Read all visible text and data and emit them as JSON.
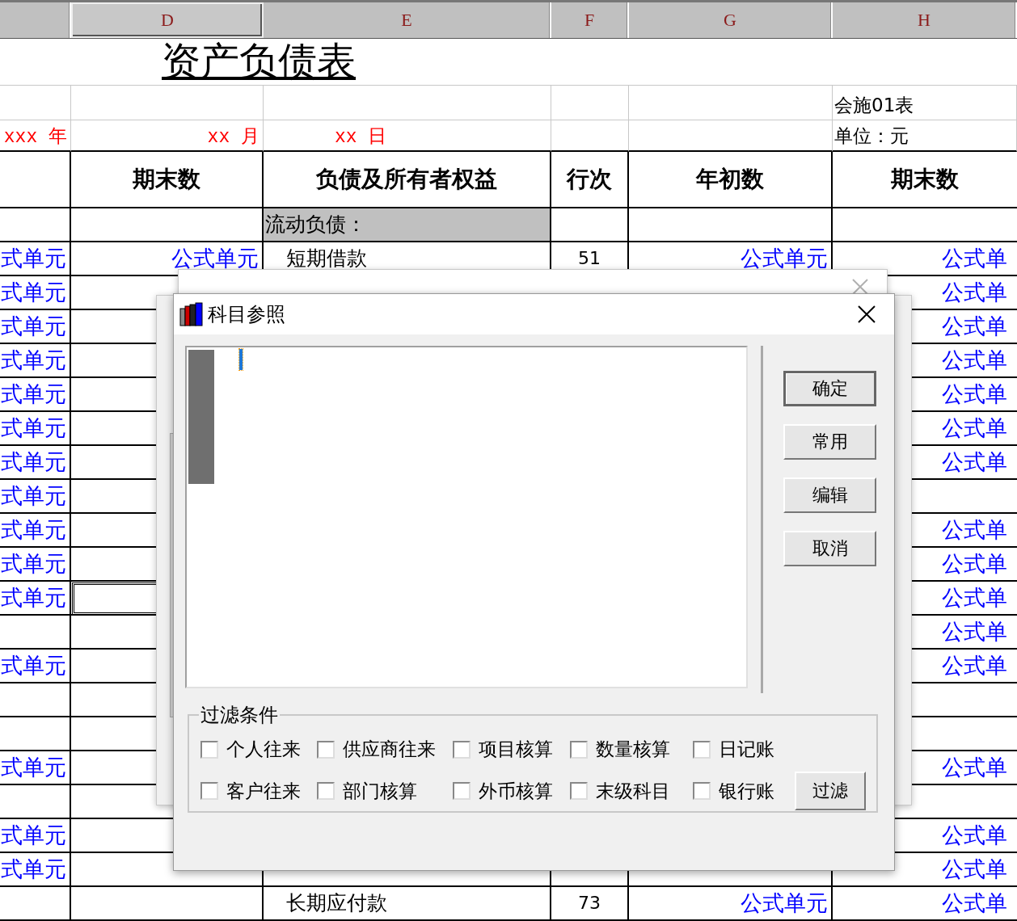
{
  "columns": [
    {
      "label": "D",
      "selected": true
    },
    {
      "label": "E",
      "selected": false
    },
    {
      "label": "F",
      "selected": false
    },
    {
      "label": "G",
      "selected": false
    },
    {
      "label": "H",
      "selected": false
    }
  ],
  "title": "资产负债表",
  "form_no": "会施01表",
  "date": {
    "year": "xxx 年",
    "month": "xx 月",
    "day": "xx 日"
  },
  "unit": "单位：元",
  "table_headers": [
    "期末数",
    "负债及所有者权益",
    "行次",
    "年初数",
    "期末数"
  ],
  "rows": [
    {
      "kind": "section",
      "selected": false,
      "cells": {
        "E": "流动负债："
      }
    },
    {
      "kind": "line",
      "selected": false,
      "cells": {
        "C": "式单元",
        "D": "公式单元",
        "E": "短期借款",
        "F": "51",
        "G": "公式单元",
        "H": "公式单"
      }
    },
    {
      "kind": "line",
      "selected": false,
      "cells": {
        "C": "式单元",
        "H": "公式单"
      }
    },
    {
      "kind": "line",
      "selected": false,
      "cells": {
        "C": "式单元",
        "H": "公式单"
      }
    },
    {
      "kind": "line",
      "selected": false,
      "cells": {
        "C": "式单元",
        "H": "公式单"
      }
    },
    {
      "kind": "line",
      "selected": false,
      "cells": {
        "C": "式单元",
        "H": "公式单"
      }
    },
    {
      "kind": "line",
      "selected": false,
      "cells": {
        "C": "式单元",
        "H": "公式单"
      }
    },
    {
      "kind": "line",
      "selected": false,
      "cells": {
        "C": "式单元",
        "H": "公式单"
      }
    },
    {
      "kind": "line",
      "selected": false,
      "cells": {
        "C": "式单元"
      }
    },
    {
      "kind": "line",
      "selected": false,
      "cells": {
        "C": "式单元",
        "H": "公式单"
      }
    },
    {
      "kind": "line",
      "selected": false,
      "cells": {
        "C": "式单元",
        "H": "公式单"
      }
    },
    {
      "kind": "line",
      "selected": true,
      "cells": {
        "C": "式单元",
        "H": "公式单"
      }
    },
    {
      "kind": "line",
      "selected": false,
      "cells": {
        "H": "公式单"
      }
    },
    {
      "kind": "line",
      "selected": false,
      "cells": {
        "C": "式单元",
        "H": "公式单"
      }
    },
    {
      "kind": "blank",
      "selected": false
    },
    {
      "kind": "blank",
      "selected": false
    },
    {
      "kind": "line",
      "selected": false,
      "cells": {
        "C": "式单元",
        "H": "公式单"
      }
    },
    {
      "kind": "blank",
      "selected": false
    },
    {
      "kind": "line",
      "selected": false,
      "cells": {
        "C": "式单元",
        "H": "公式单"
      }
    },
    {
      "kind": "line",
      "selected": false,
      "cells": {
        "C": "式单元",
        "H": "公式单"
      }
    },
    {
      "kind": "line",
      "selected": false,
      "cells": {
        "E": "长期应付款",
        "F": "73",
        "G": "公式单元",
        "H": "公式单"
      }
    }
  ],
  "account_dialog": {
    "title": "科目参照",
    "buttons": [
      {
        "label": "确定",
        "default": true
      },
      {
        "label": "常用",
        "default": false
      },
      {
        "label": "编辑",
        "default": false
      },
      {
        "label": "取消",
        "default": false
      }
    ],
    "filter": {
      "title": "过滤条件",
      "checkboxes": [
        {
          "label": "个人往来",
          "checked": false
        },
        {
          "label": "供应商往来",
          "checked": false
        },
        {
          "label": "项目核算",
          "checked": false
        },
        {
          "label": "数量核算",
          "checked": false
        },
        {
          "label": "日记账",
          "checked": false
        },
        {
          "label": "客户往来",
          "checked": false
        },
        {
          "label": "部门核算",
          "checked": false
        },
        {
          "label": "外币核算",
          "checked": false
        },
        {
          "label": "末级科目",
          "checked": false
        },
        {
          "label": "银行账",
          "checked": false
        }
      ],
      "button": "过滤"
    }
  }
}
